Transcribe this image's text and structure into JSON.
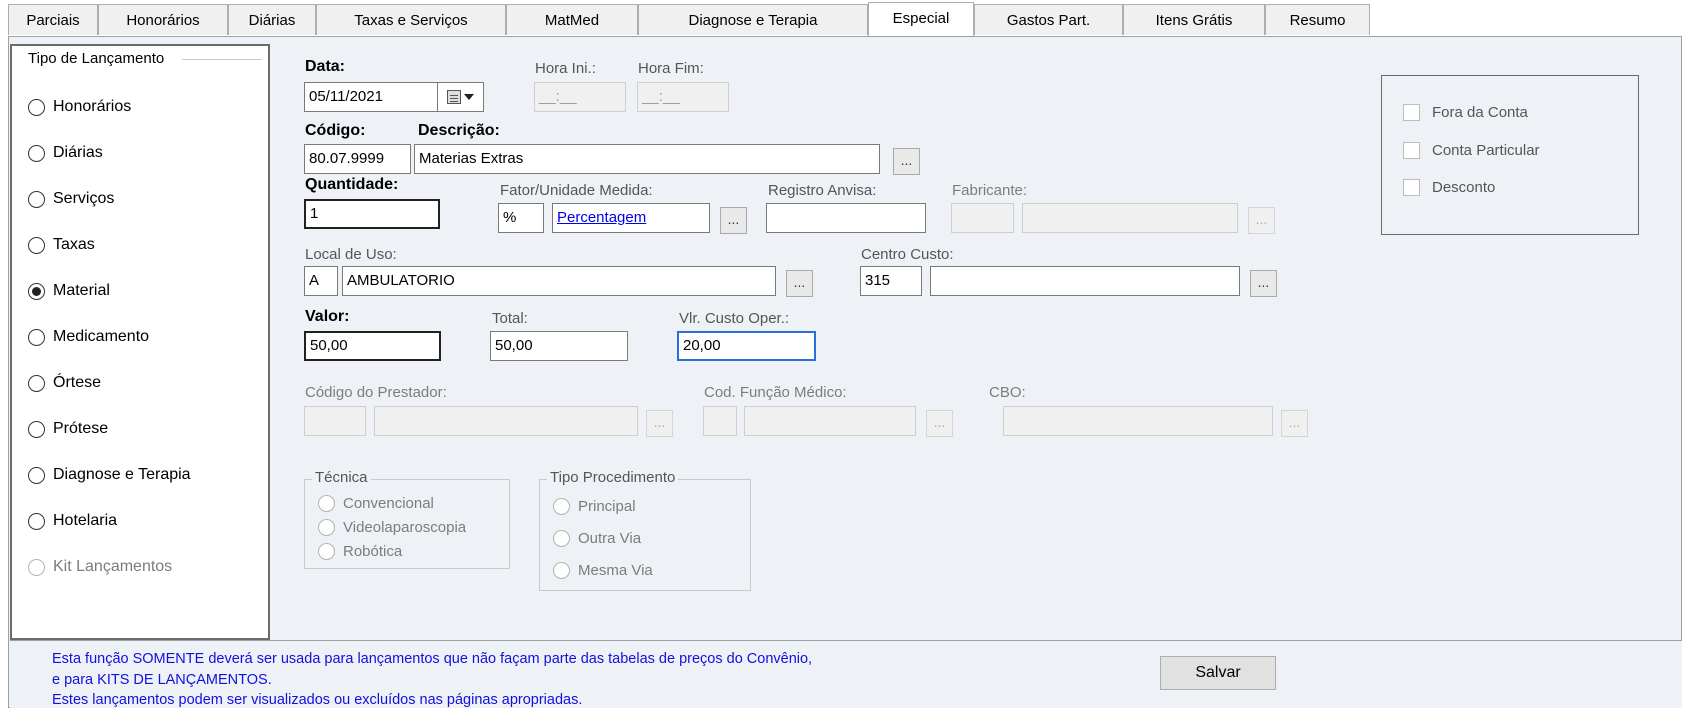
{
  "tabs": [
    "Parciais",
    "Honorários",
    "Diárias",
    "Taxas e Serviços",
    "MatMed",
    "Diagnose e Terapia",
    "Especial",
    "Gastos Part.",
    "Itens Grátis",
    "Resumo"
  ],
  "active_tab": "Especial",
  "tipo_lancamento": {
    "title": "Tipo de Lançamento",
    "options": [
      "Honorários",
      "Diárias",
      "Serviços",
      "Taxas",
      "Material",
      "Medicamento",
      "Órtese",
      "Prótese",
      "Diagnose e Terapia",
      "Hotelaria",
      "Kit Lançamentos"
    ],
    "selected": "Material"
  },
  "form": {
    "data_label": "Data:",
    "data_value": "05/11/2021",
    "hora_ini_label": "Hora Ini.:",
    "hora_ini_value": "__:__",
    "hora_fim_label": "Hora Fim:",
    "hora_fim_value": "__:__",
    "codigo_label": "Código:",
    "codigo_value": "80.07.9999",
    "descricao_label": "Descrição:",
    "descricao_value": "Materias Extras",
    "quantidade_label": "Quantidade:",
    "quantidade_value": "1",
    "fator_label": "Fator/Unidade Medida:",
    "fator_symbol": "%",
    "fator_value": "Percentagem",
    "registro_label": "Registro Anvisa:",
    "registro_value": "",
    "fabricante_label": "Fabricante:",
    "local_label": "Local de Uso:",
    "local_code": "A",
    "local_value": "AMBULATORIO",
    "centro_label": "Centro Custo:",
    "centro_code": "315",
    "centro_value": "",
    "valor_label": "Valor:",
    "valor_value": "50,00",
    "total_label": "Total:",
    "total_value": "50,00",
    "vlr_custo_label": "Vlr. Custo Oper.:",
    "vlr_custo_value": "20,00",
    "prestador_label": "Código do Prestador:",
    "funcao_label": "Cod. Função Médico:",
    "cbo_label": "CBO:",
    "ellipsis": "..."
  },
  "tecnica": {
    "title": "Técnica",
    "options": [
      "Convencional",
      "Videolaparoscopia",
      "Robótica"
    ]
  },
  "tipo_procedimento": {
    "title": "Tipo Procedimento",
    "options": [
      "Principal",
      "Outra Via",
      "Mesma Via"
    ]
  },
  "flags": [
    "Fora da Conta",
    "Conta Particular",
    "Desconto"
  ],
  "notes": [
    "Esta função SOMENTE deverá ser usada  para lançamentos que não façam parte das tabelas de preços do Convênio,",
    "e para  KITS DE LANÇAMENTOS.",
    "Estes  lançamentos podem  ser  visualizados ou   excluídos nas páginas apropriadas."
  ],
  "salvar_label": "Salvar"
}
